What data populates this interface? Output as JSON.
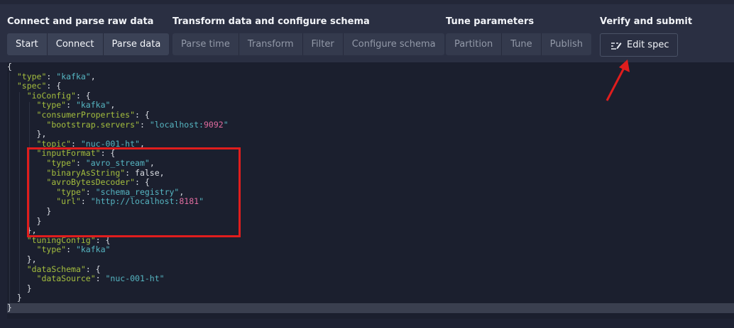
{
  "steps": {
    "groups": [
      {
        "title": "Connect and parse raw data",
        "buttons": [
          "Start",
          "Connect",
          "Parse data"
        ]
      },
      {
        "title": "Transform data and configure schema",
        "buttons": [
          "Parse time",
          "Transform",
          "Filter",
          "Configure schema"
        ]
      },
      {
        "title": "Tune parameters",
        "buttons": [
          "Partition",
          "Tune",
          "Publish"
        ]
      },
      {
        "title": "Verify and submit",
        "buttons": [
          "Edit spec"
        ]
      }
    ],
    "edit_icon": "edit-spec-icon"
  },
  "spec_lines": [
    [
      [
        "p",
        "{"
      ]
    ],
    [
      [
        "p",
        "  "
      ],
      [
        "k",
        "\"type\""
      ],
      [
        "p",
        ": "
      ],
      [
        "s",
        "\"kafka\""
      ],
      [
        "p",
        ","
      ]
    ],
    [
      [
        "p",
        "  "
      ],
      [
        "k",
        "\"spec\""
      ],
      [
        "p",
        ": {"
      ]
    ],
    [
      [
        "p",
        "    "
      ],
      [
        "k",
        "\"ioConfig\""
      ],
      [
        "p",
        ": {"
      ]
    ],
    [
      [
        "p",
        "      "
      ],
      [
        "k",
        "\"type\""
      ],
      [
        "p",
        ": "
      ],
      [
        "s",
        "\"kafka\""
      ],
      [
        "p",
        ","
      ]
    ],
    [
      [
        "p",
        "      "
      ],
      [
        "k",
        "\"consumerProperties\""
      ],
      [
        "p",
        ": {"
      ]
    ],
    [
      [
        "p",
        "        "
      ],
      [
        "k",
        "\"bootstrap.servers\""
      ],
      [
        "p",
        ": "
      ],
      [
        "s",
        "\"localhost:"
      ],
      [
        "n",
        "9092"
      ],
      [
        "s",
        "\""
      ]
    ],
    [
      [
        "p",
        "      },"
      ]
    ],
    [
      [
        "p",
        "      "
      ],
      [
        "k",
        "\"topic\""
      ],
      [
        "p",
        ": "
      ],
      [
        "s",
        "\"nuc-001-ht\""
      ],
      [
        "p",
        ","
      ]
    ],
    [
      [
        "p",
        "      "
      ],
      [
        "k",
        "\"inputFormat\""
      ],
      [
        "p",
        ": {"
      ]
    ],
    [
      [
        "p",
        "        "
      ],
      [
        "k",
        "\"type\""
      ],
      [
        "p",
        ": "
      ],
      [
        "s",
        "\"avro_stream\""
      ],
      [
        "p",
        ","
      ]
    ],
    [
      [
        "p",
        "        "
      ],
      [
        "k",
        "\"binaryAsString\""
      ],
      [
        "p",
        ": false,"
      ]
    ],
    [
      [
        "p",
        "        "
      ],
      [
        "k",
        "\"avroBytesDecoder\""
      ],
      [
        "p",
        ": {"
      ]
    ],
    [
      [
        "p",
        "          "
      ],
      [
        "k",
        "\"type\""
      ],
      [
        "p",
        ": "
      ],
      [
        "s",
        "\"schema_registry\""
      ],
      [
        "p",
        ","
      ]
    ],
    [
      [
        "p",
        "          "
      ],
      [
        "k",
        "\"url\""
      ],
      [
        "p",
        ": "
      ],
      [
        "s",
        "\"http://localhost:"
      ],
      [
        "n",
        "8181"
      ],
      [
        "s",
        "\""
      ]
    ],
    [
      [
        "p",
        "        }"
      ]
    ],
    [
      [
        "p",
        "      }"
      ]
    ],
    [
      [
        "p",
        "    },"
      ]
    ],
    [
      [
        "p",
        "    "
      ],
      [
        "k",
        "\"tuningConfig\""
      ],
      [
        "p",
        ": {"
      ]
    ],
    [
      [
        "p",
        "      "
      ],
      [
        "k",
        "\"type\""
      ],
      [
        "p",
        ": "
      ],
      [
        "s",
        "\"kafka\""
      ]
    ],
    [
      [
        "p",
        "    },"
      ]
    ],
    [
      [
        "p",
        "    "
      ],
      [
        "k",
        "\"dataSchema\""
      ],
      [
        "p",
        ": {"
      ]
    ],
    [
      [
        "p",
        "      "
      ],
      [
        "k",
        "\"dataSource\""
      ],
      [
        "p",
        ": "
      ],
      [
        "s",
        "\"nuc-001-ht\""
      ]
    ],
    [
      [
        "p",
        "    }"
      ]
    ],
    [
      [
        "p",
        "  }"
      ]
    ],
    [
      [
        "p",
        "}"
      ]
    ]
  ],
  "current_line": 25,
  "annotation": {
    "highlight": "inputFormat",
    "arrow_target": "Edit spec"
  }
}
